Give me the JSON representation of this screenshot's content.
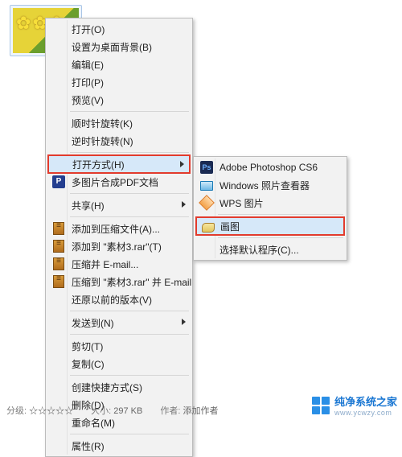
{
  "thumb": {
    "name": "sunflower-image"
  },
  "menu": {
    "open": "打开(O)",
    "setBg": "设置为桌面背景(B)",
    "edit": "编辑(E)",
    "print": "打印(P)",
    "preview": "预览(V)",
    "rotateCw": "顺时针旋转(K)",
    "rotateCcw": "逆时针旋转(N)",
    "openWith": "打开方式(H)",
    "mergePdf": "多图片合成PDF文档",
    "share": "共享(H)",
    "addArchive": "添加到压缩文件(A)...",
    "addTo": "添加到 \"素材3.rar\"(T)",
    "compressEmail": "压缩并 E-mail...",
    "compressToEmail": "压缩到 \"素材3.rar\" 并 E-mail",
    "restore": "还原以前的版本(V)",
    "sendTo": "发送到(N)",
    "cut": "剪切(T)",
    "copy": "复制(C)",
    "shortcut": "创建快捷方式(S)",
    "delete": "删除(D)",
    "rename": "重命名(M)",
    "properties": "属性(R)"
  },
  "submenu": {
    "ps": "Adobe Photoshop CS6",
    "viewer": "Windows 照片查看器",
    "wps": "WPS 图片",
    "paint": "画图",
    "choose": "选择默认程序(C)..."
  },
  "status": {
    "ratingLabel": "分级:",
    "sizeLabel": "大小:",
    "sizeValue": "297 KB",
    "authorLabel": "作者:",
    "authorValue": "添加作者"
  },
  "watermark": {
    "brand": "纯净系统之家",
    "url": "www.ycwzy.com"
  }
}
